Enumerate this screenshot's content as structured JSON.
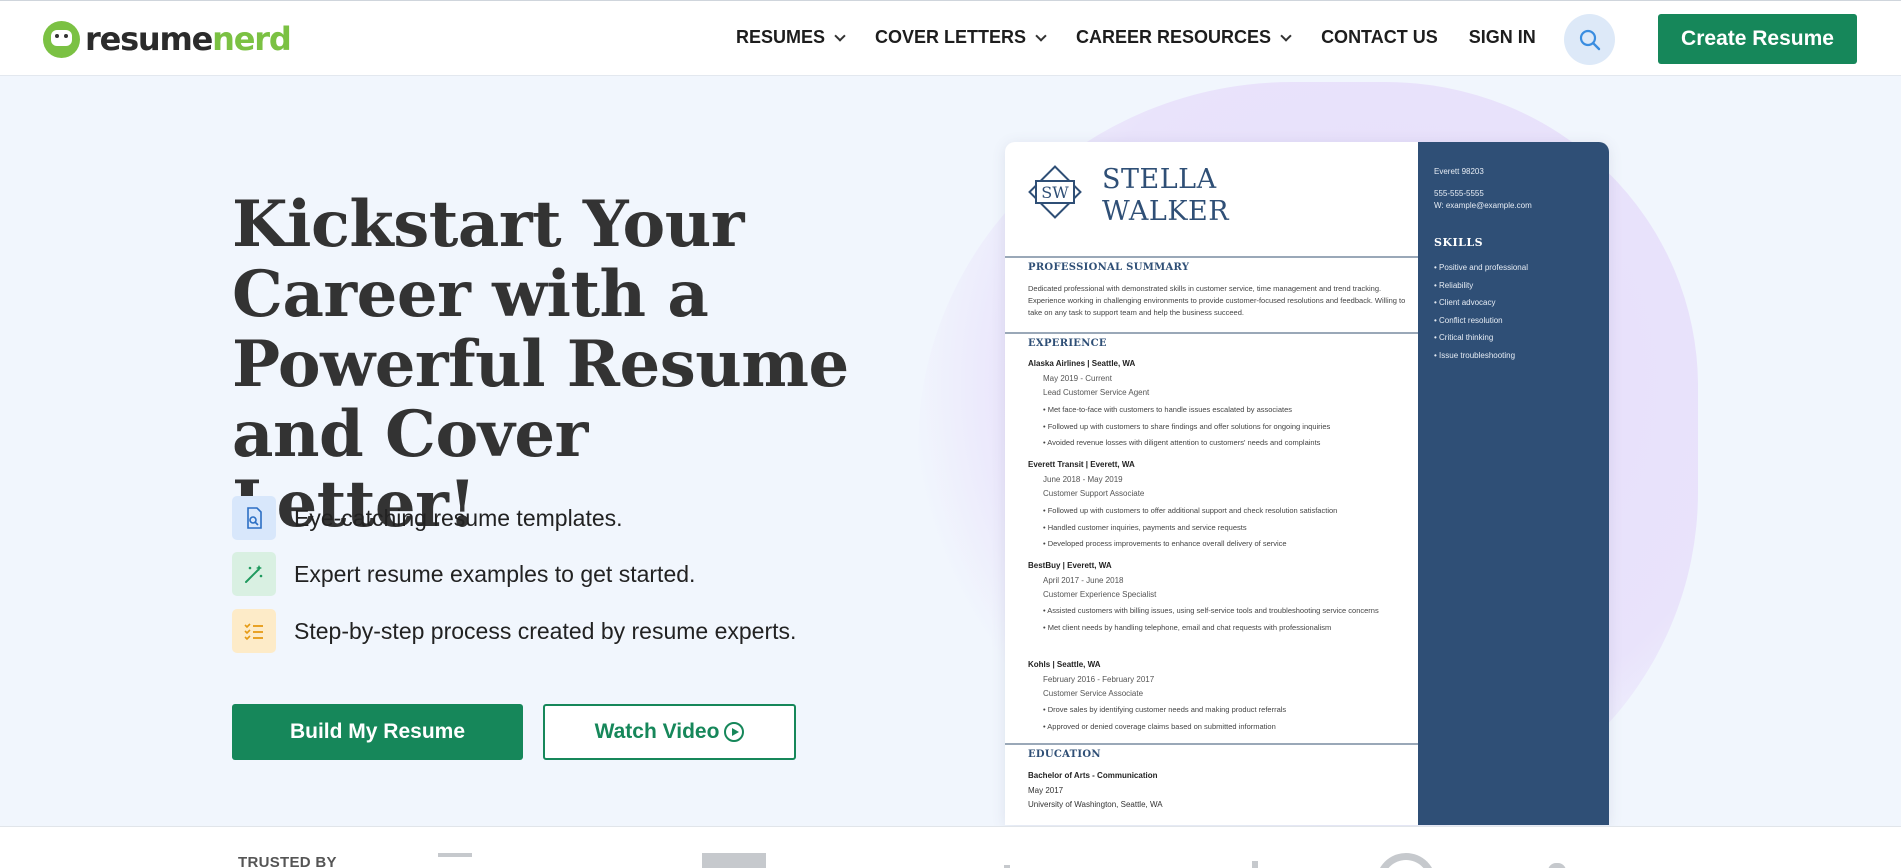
{
  "header": {
    "logo_part1": "resume",
    "logo_part2": "nerd",
    "nav": [
      {
        "label": "RESUMES",
        "dropdown": true
      },
      {
        "label": "COVER LETTERS",
        "dropdown": true
      },
      {
        "label": "CAREER RESOURCES",
        "dropdown": true
      },
      {
        "label": "CONTACT US",
        "dropdown": false
      },
      {
        "label": "SIGN IN",
        "dropdown": false
      }
    ],
    "search_icon": "search-icon",
    "create_button": "Create Resume"
  },
  "hero": {
    "title": "Kickstart Your Career with a Powerful Resume and Cover Letter!",
    "features": [
      {
        "icon": "document-icon",
        "text": "Eye-catching resume templates."
      },
      {
        "icon": "magic-wand-icon",
        "text": "Expert resume examples to get started."
      },
      {
        "icon": "checklist-icon",
        "text": "Step-by-step process created by resume experts."
      }
    ],
    "build_button": "Build My Resume",
    "watch_button": "Watch Video"
  },
  "resume": {
    "monogram": "SW",
    "first_name": "STELLA",
    "last_name": "WALKER",
    "contact": [
      "Everett 98203",
      "555-555-5555",
      "W: example@example.com"
    ],
    "skills_heading": "SKILLS",
    "skills": [
      "Positive and professional",
      "Reliability",
      "Client advocacy",
      "Conflict resolution",
      "Critical thinking",
      "Issue troubleshooting"
    ],
    "summary_heading": "PROFESSIONAL SUMMARY",
    "summary": "Dedicated professional with demonstrated skills in customer service, time management and trend tracking. Experience working in challenging environments to provide customer-focused resolutions and feedback. Willing to take on any task to support team and help the business succeed.",
    "experience_heading": "EXPERIENCE",
    "jobs": [
      {
        "company": "Alaska Airlines | Seattle, WA",
        "dates": "May 2019 - Current",
        "title": "Lead Customer Service Agent",
        "bullets": [
          "Met face-to-face with customers to handle issues escalated by associates",
          "Followed up with customers to share findings and offer solutions for ongoing inquiries",
          "Avoided revenue losses with diligent attention to customers' needs and complaints"
        ]
      },
      {
        "company": "Everett Transit | Everett, WA",
        "dates": "June 2018 - May 2019",
        "title": "Customer Support Associate",
        "bullets": [
          "Followed up with customers to offer additional support and check resolution satisfaction",
          "Handled customer inquiries, payments and service requests",
          "Developed process improvements to enhance overall delivery of service"
        ]
      },
      {
        "company": "BestBuy | Everett, WA",
        "dates": "April 2017 - June 2018",
        "title": "Customer Experience Specialist",
        "bullets": [
          "Assisted customers with billing issues, using self-service tools and troubleshooting service concerns",
          "Met client needs by handling telephone, email and chat requests with professionalism"
        ]
      },
      {
        "company": "Kohls | Seattle, WA",
        "dates": "February 2016 - February 2017",
        "title": "Customer Service Associate",
        "bullets": [
          "Drove sales by identifying customer needs and making product referrals",
          "Approved or denied coverage claims based on submitted information"
        ]
      }
    ],
    "education_heading": "EDUCATION",
    "degree": "Bachelor of Arts - Communication",
    "grad_date": "May 2017",
    "school": "University of Washington, Seattle, WA"
  },
  "trusted": {
    "label": "TRUSTED BY"
  },
  "colors": {
    "brand_green": "#16875a",
    "logo_green": "#7bc143",
    "resume_navy": "#2f4f76",
    "hero_bg": "#f1f6fd"
  }
}
